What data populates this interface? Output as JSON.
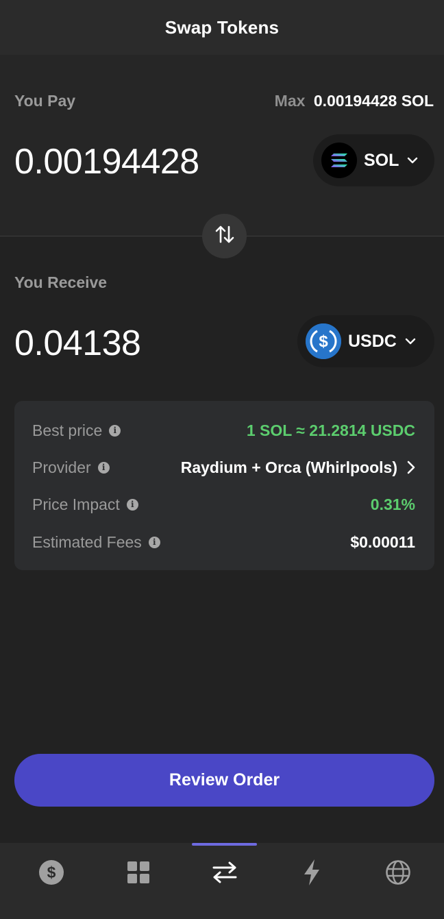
{
  "header": {
    "title": "Swap Tokens"
  },
  "pay": {
    "label": "You Pay",
    "max_label": "Max",
    "max_value": "0.00194428 SOL",
    "amount": "0.00194428",
    "token": {
      "symbol": "SOL",
      "icon": "solana-icon"
    }
  },
  "receive": {
    "label": "You Receive",
    "amount": "0.04138",
    "token": {
      "symbol": "USDC",
      "icon": "usdc-icon"
    }
  },
  "details": [
    {
      "label": "Best price",
      "value": "1 SOL ≈ 21.2814 USDC",
      "color": "#5ccd6e"
    },
    {
      "label": "Provider",
      "value": "Raydium + Orca (Whirlpools)",
      "color": "#ffffff"
    },
    {
      "label": "Price Impact",
      "value": "0.31%",
      "color": "#5ccd6e"
    },
    {
      "label": "Estimated Fees",
      "value": "$0.00011",
      "color": "#ffffff"
    }
  ],
  "review_button": {
    "label": "Review Order"
  },
  "tabs": [
    {
      "icon": "dollar-icon",
      "active": false
    },
    {
      "icon": "grid-icon",
      "active": false
    },
    {
      "icon": "swap-arrows-icon",
      "active": true
    },
    {
      "icon": "lightning-icon",
      "active": false
    },
    {
      "icon": "globe-icon",
      "active": false
    }
  ],
  "colors": {
    "accent": "#4a47c6",
    "positive": "#5ccd6e",
    "background": "#222222"
  }
}
